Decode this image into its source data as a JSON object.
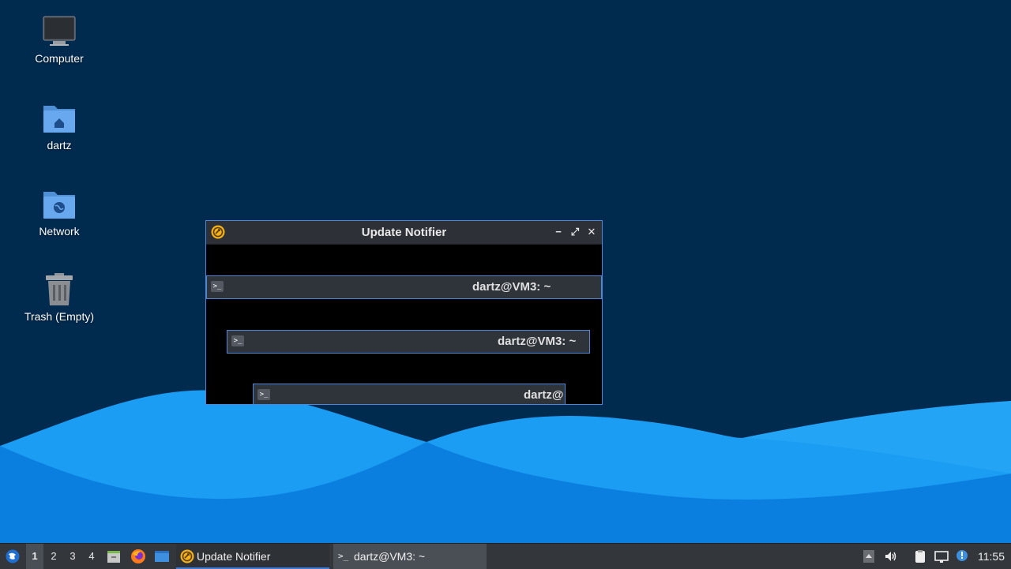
{
  "desktop": {
    "icons": [
      {
        "label": "Computer",
        "icon": "computer-icon"
      },
      {
        "label": "dartz",
        "icon": "home-folder-icon"
      },
      {
        "label": "Network",
        "icon": "network-folder-icon"
      },
      {
        "label": "Trash (Empty)",
        "icon": "trash-icon"
      }
    ]
  },
  "window": {
    "title": "Update Notifier",
    "app_icon": "update-notifier-icon",
    "controls": {
      "minimize": "−",
      "maximize": "⤢",
      "close": "✕"
    },
    "trails": [
      {
        "title": "dartz@VM3: ~",
        "icon_text": ">_"
      },
      {
        "title": "dartz@VM3: ~",
        "icon_text": ">_"
      },
      {
        "title": "dartz@",
        "icon_text": ">_"
      }
    ]
  },
  "taskbar": {
    "menu_icon": "start-menu-icon",
    "workspaces": [
      "1",
      "2",
      "3",
      "4"
    ],
    "active_workspace": "1",
    "launchers": [
      "file-manager-icon",
      "firefox-icon",
      "show-desktop-icon"
    ],
    "tasks": [
      {
        "label": "Update Notifier",
        "icon": "update-notifier-icon",
        "active": true
      },
      {
        "label": "dartz@VM3: ~",
        "icon": "terminal-icon",
        "active": false
      }
    ],
    "tray": [
      "expand-tray-icon",
      "volume-icon",
      "clipboard-icon",
      "network-icon",
      "notification-icon"
    ],
    "clock": "11:55"
  },
  "colors": {
    "desktop_bg": "#012a4f",
    "wave_light": "#1a9df2",
    "wave_mid": "#0b7fe0",
    "accent": "#4e86d8",
    "taskbar_bg": "#33363b"
  }
}
